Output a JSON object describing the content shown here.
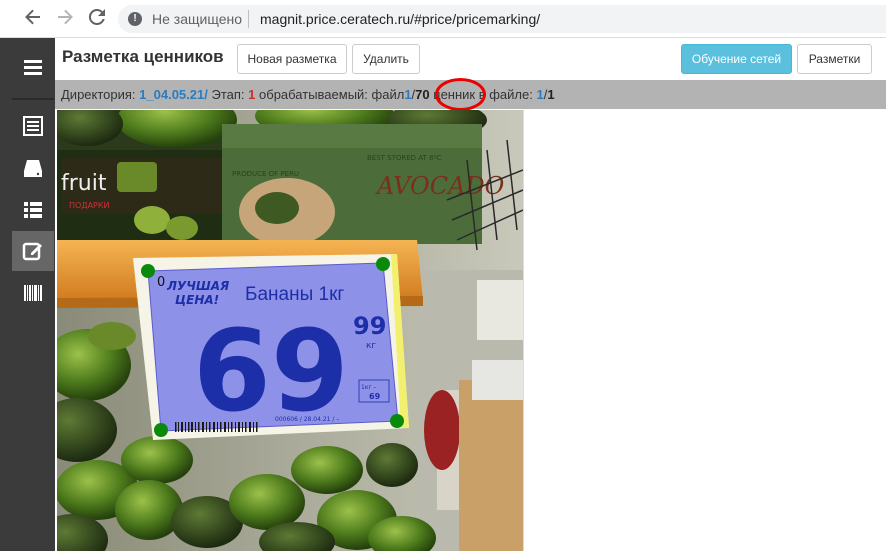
{
  "browser": {
    "not_secure": "Не защищено",
    "url": "magnit.price.ceratech.ru/#price/pricemarking/"
  },
  "header": {
    "title": "Разметка ценников",
    "new_label": "Новая разметка",
    "delete_label": "Удалить",
    "train_label": "Обучение сетей",
    "markings_label": "Разметки"
  },
  "status": {
    "dir_label": "Директория:",
    "dir_value": "1_04.05.21/",
    "stage_label": "Этап:",
    "stage_value": "1",
    "file_label": "обрабатываемый: файл",
    "file_current": "1",
    "file_total": "70",
    "price_label": "ценник в файле:",
    "price_current": "1",
    "price_total": "1"
  },
  "tag": {
    "slogan_1": "ЛУЧШАЯ",
    "slogan_2": "ЦЕНА!",
    "product": "Бананы 1кг",
    "price_main": "69",
    "price_cents": "99",
    "unit": "кг",
    "per_kg_1": "1кг –",
    "per_kg_2": "69",
    "barcode_text": "000606 / 28.04.21 / –",
    "zero_label": "0",
    "box_1": "BEST STORED AT 8ºC",
    "box_2": "PRODUCE OF PERU",
    "box_3": "AVOCADO",
    "fruit_word": "fruit",
    "fruit_sub": "ПОДАРКИ"
  },
  "colors": {
    "accent": "#5bc0de",
    "sidebar": "#3b3b3b",
    "statusbar": "#b3b3b3",
    "overlay": "#7b7fe8",
    "handle": "#0a8a0a",
    "circle": "#ee0000"
  }
}
